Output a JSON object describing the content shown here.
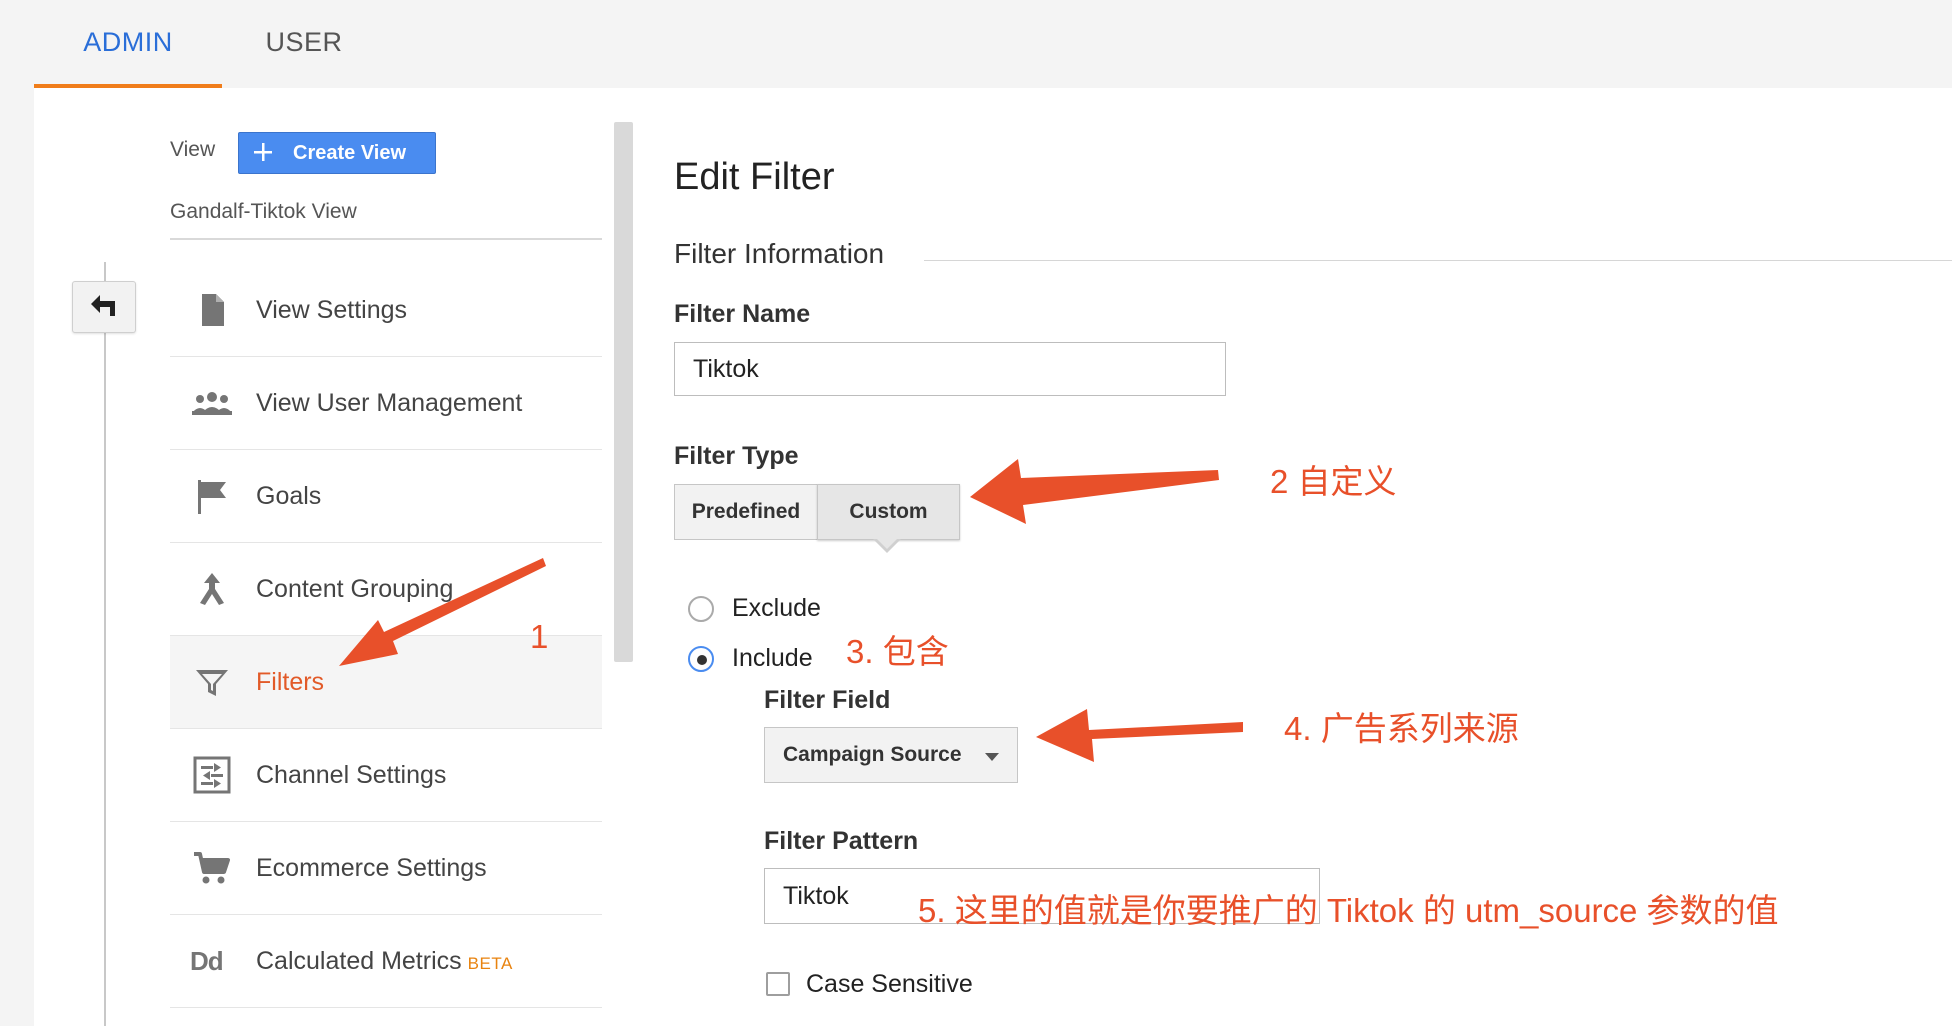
{
  "tabs": [
    {
      "label": "ADMIN",
      "active": true
    },
    {
      "label": "USER",
      "active": false
    }
  ],
  "view": {
    "label": "View",
    "create_button": "Create View",
    "name": "Gandalf-Tiktok View"
  },
  "sidebar": {
    "items": [
      {
        "label": "View Settings",
        "icon": "document-icon"
      },
      {
        "label": "View User Management",
        "icon": "users-icon"
      },
      {
        "label": "Goals",
        "icon": "flag-icon"
      },
      {
        "label": "Content Grouping",
        "icon": "merge-icon"
      },
      {
        "label": "Filters",
        "icon": "funnel-icon",
        "active": true
      },
      {
        "label": "Channel Settings",
        "icon": "channel-settings-icon"
      },
      {
        "label": "Ecommerce Settings",
        "icon": "cart-icon"
      },
      {
        "label": "Calculated Metrics",
        "icon": "dd-icon",
        "badge": "BETA"
      }
    ]
  },
  "main": {
    "title": "Edit Filter",
    "section_title": "Filter Information",
    "filter_name": {
      "label": "Filter Name",
      "value": "Tiktok"
    },
    "filter_type": {
      "label": "Filter Type",
      "options": [
        "Predefined",
        "Custom"
      ],
      "selected": "Custom"
    },
    "mode": {
      "options": [
        "Exclude",
        "Include"
      ],
      "selected": "Include"
    },
    "filter_field": {
      "label": "Filter Field",
      "value": "Campaign Source"
    },
    "filter_pattern": {
      "label": "Filter Pattern",
      "value": "Tiktok"
    },
    "case_sensitive": {
      "label": "Case Sensitive",
      "checked": false
    }
  },
  "annotations": {
    "a1": "1",
    "a2": "2 自定义",
    "a3": "3. 包含",
    "a4": "4. 广告系列来源",
    "a5": "5. 这里的值就是你要推广的 Tiktok 的 utm_source 参数的值"
  },
  "colors": {
    "accent_blue": "#4a8cf0",
    "tab_underline": "#f07d1a",
    "active_item": "#e25a28",
    "annotation": "#e8502a"
  }
}
